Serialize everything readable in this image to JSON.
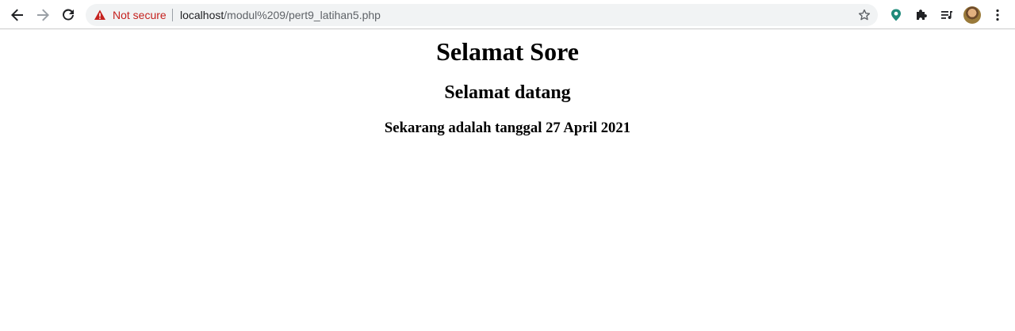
{
  "browser": {
    "omnibox": {
      "security_label": "Not secure",
      "url_host": "localhost",
      "url_path": "/modul%209/pert9_latihan5.php"
    },
    "icons": {
      "back": "back-arrow-icon",
      "forward": "forward-arrow-icon",
      "reload": "reload-icon",
      "warning": "warning-triangle-icon",
      "bookmark": "star-icon",
      "extension_1": "teal-extension-icon",
      "extensions": "puzzle-icon",
      "reading_list": "reading-list-icon",
      "profile": "avatar",
      "menu": "kebab-menu-icon"
    },
    "colors": {
      "security_warning": "#c5221f",
      "omnibox_bg": "#f1f3f4",
      "extension_teal": "#1e8a7a"
    }
  },
  "page": {
    "heading1": "Selamat Sore",
    "heading2": "Selamat datang",
    "heading3": "Sekarang adalah tanggal 27 April 2021"
  }
}
